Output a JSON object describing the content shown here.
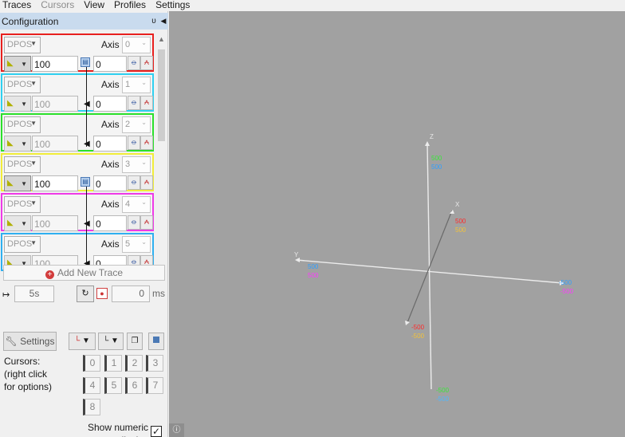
{
  "menu": [
    "Traces",
    "Cursors",
    "View",
    "Profiles",
    "Settings"
  ],
  "panel": {
    "title": "Configuration",
    "pin_icon": "pin-icon",
    "collapse_icon": "triangle-left-icon"
  },
  "traces": [
    {
      "signal": "DPOS",
      "axis_label": "Axis",
      "axis": "0",
      "scale": "100",
      "offset": "0",
      "color": "#e8201e"
    },
    {
      "signal": "DPOS",
      "axis_label": "Axis",
      "axis": "1",
      "scale": "100",
      "offset": "0",
      "color": "#2fd0f0"
    },
    {
      "signal": "DPOS",
      "axis_label": "Axis",
      "axis": "2",
      "scale": "100",
      "offset": "0",
      "color": "#2be02b"
    },
    {
      "signal": "DPOS",
      "axis_label": "Axis",
      "axis": "3",
      "scale": "100",
      "offset": "0",
      "color": "#f1ed3a"
    },
    {
      "signal": "DPOS",
      "axis_label": "Axis",
      "axis": "4",
      "scale": "100",
      "offset": "0",
      "color": "#ef3ae7"
    },
    {
      "signal": "DPOS",
      "axis_label": "Axis",
      "axis": "5",
      "scale": "100",
      "offset": "0",
      "color": "#2fb0f0"
    }
  ],
  "add_trace_label": "Add New Trace",
  "timebase": {
    "window": "5s",
    "delay": "0",
    "unit": "ms"
  },
  "settings_label": "Settings",
  "cursors": {
    "label": "Cursors:\n(right click\nfor options)",
    "buttons": [
      "0",
      "1",
      "2",
      "3",
      "4",
      "5",
      "6",
      "7",
      "8"
    ]
  },
  "show_numeric": {
    "label": "Show numeric\ndisplay",
    "checked": true
  },
  "plot": {
    "axes": {
      "x": "X",
      "y": "Y",
      "z": "Z"
    },
    "labels": {
      "z_pos_a": "500",
      "z_pos_b": "500",
      "x_pos_a": "500",
      "x_pos_b": "500",
      "y_pos_a": "500",
      "y_pos_b": "500",
      "y_neg_a": "-500",
      "y_neg_b": "-500",
      "x_neg_a": "-500",
      "x_neg_b": "-500",
      "z_neg_a": "-500",
      "z_neg_b": "-500"
    },
    "colors": {
      "red": "#ff2a2a",
      "orange": "#f2c23a",
      "blue": "#2f9fff",
      "green": "#3ae63a",
      "magenta": "#ff3aff",
      "light_blue": "#4fb8ff"
    }
  }
}
